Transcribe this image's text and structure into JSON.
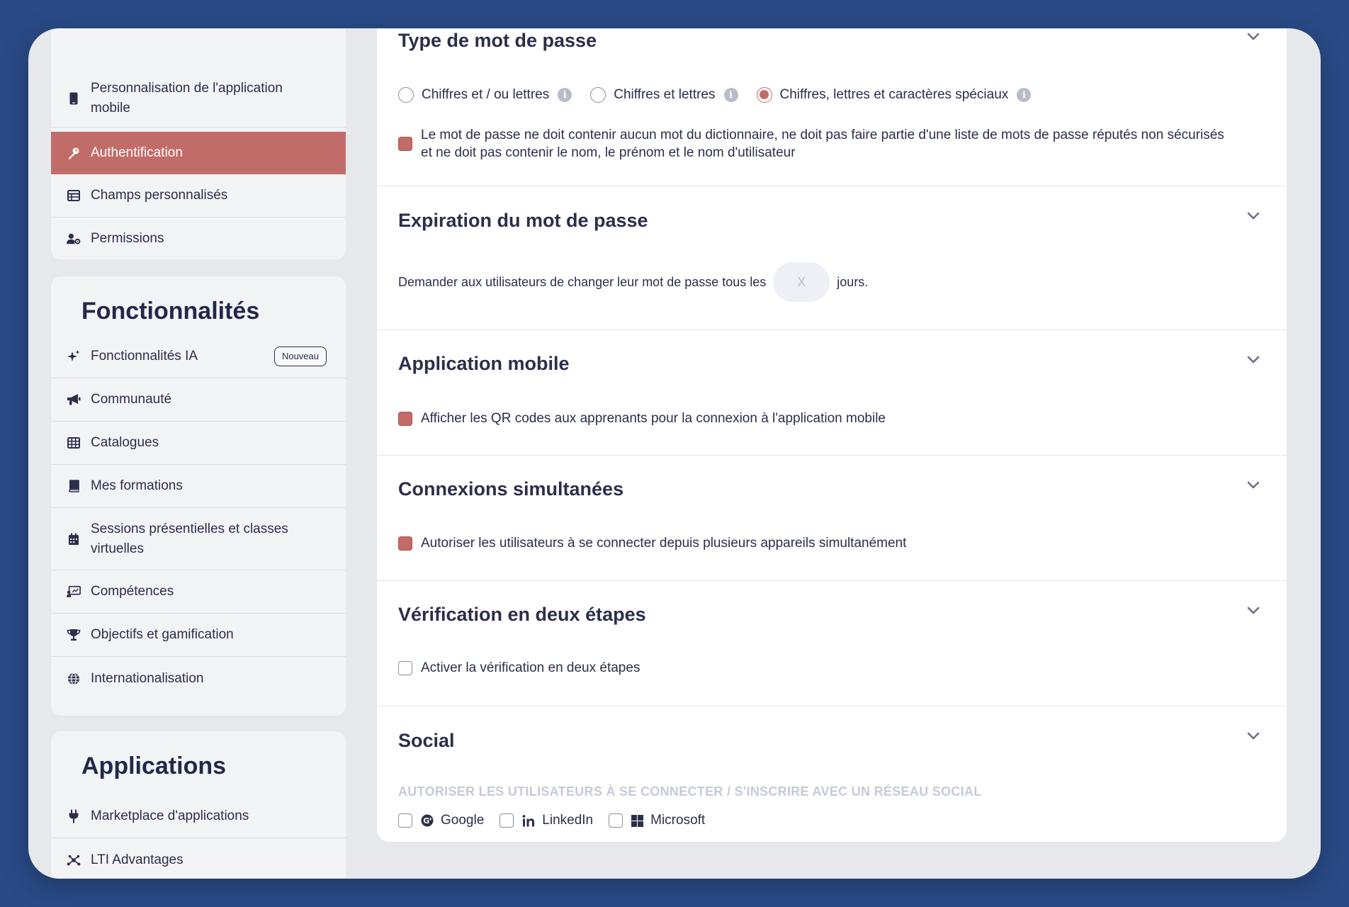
{
  "sidebar": {
    "top_items": [
      {
        "label": "Personnalisation de l'application mobile",
        "icon": "mobile-icon"
      },
      {
        "label": "Authentification",
        "icon": "key-icon"
      },
      {
        "label": "Champs personnalisés",
        "icon": "table-icon"
      },
      {
        "label": "Permissions",
        "icon": "user-gear-icon"
      }
    ],
    "features": {
      "title": "Fonctionnalités",
      "items": [
        {
          "label": "Fonctionnalités IA",
          "icon": "sparkles-icon",
          "badge": "Nouveau"
        },
        {
          "label": "Communauté",
          "icon": "megaphone-icon"
        },
        {
          "label": "Catalogues",
          "icon": "grid-icon"
        },
        {
          "label": "Mes formations",
          "icon": "book-icon"
        },
        {
          "label": "Sessions présentielles et classes virtuelles",
          "icon": "calendar-icon"
        },
        {
          "label": "Compétences",
          "icon": "presentation-icon"
        },
        {
          "label": "Objectifs et gamification",
          "icon": "trophy-icon"
        },
        {
          "label": "Internationalisation",
          "icon": "globe-icon"
        }
      ]
    },
    "applications": {
      "title": "Applications",
      "items": [
        {
          "label": "Marketplace d'applications",
          "icon": "plug-icon"
        },
        {
          "label": "LTI Advantages",
          "icon": "network-icon"
        }
      ]
    }
  },
  "main": {
    "password_type": {
      "title": "Type de mot de passe",
      "options": [
        {
          "label": "Chiffres et / ou lettres",
          "selected": false
        },
        {
          "label": "Chiffres et lettres",
          "selected": false
        },
        {
          "label": "Chiffres, lettres et caractères spéciaux",
          "selected": true
        }
      ],
      "dictionary_check": {
        "line1": "Le mot de passe ne doit contenir aucun mot du dictionnaire, ne doit pas faire partie d'une liste de mots de passe réputés non sécurisés",
        "line2": "et ne doit pas contenir le nom, le prénom et le nom d'utilisateur",
        "checked": true
      }
    },
    "expiration": {
      "title": "Expiration du mot de passe",
      "prefix": "Demander aux utilisateurs de changer leur mot de passe tous les",
      "placeholder": "X",
      "suffix": "jours."
    },
    "mobile": {
      "title": "Application mobile",
      "option": "Afficher les QR codes aux apprenants pour la connexion à l'application mobile",
      "checked": true
    },
    "simultaneous": {
      "title": "Connexions simultanées",
      "option": "Autoriser les utilisateurs à se connecter depuis plusieurs appareils simultanément",
      "checked": true
    },
    "two_step": {
      "title": "Vérification en deux étapes",
      "option": "Activer la vérification en deux étapes",
      "checked": false
    },
    "social": {
      "title": "Social",
      "caption": "AUTORISER LES UTILISATEURS À SE CONNECTER / S'INSCRIRE AVEC UN RÉSEAU SOCIAL",
      "providers": [
        {
          "label": "Google",
          "icon": "google-icon",
          "checked": false
        },
        {
          "label": "LinkedIn",
          "icon": "linkedin-icon",
          "checked": false
        },
        {
          "label": "Microsoft",
          "icon": "microsoft-icon",
          "checked": false
        }
      ]
    }
  },
  "colors": {
    "accent": "#c26c69",
    "background": "#2a4a86",
    "text": "#2b2f4a"
  }
}
